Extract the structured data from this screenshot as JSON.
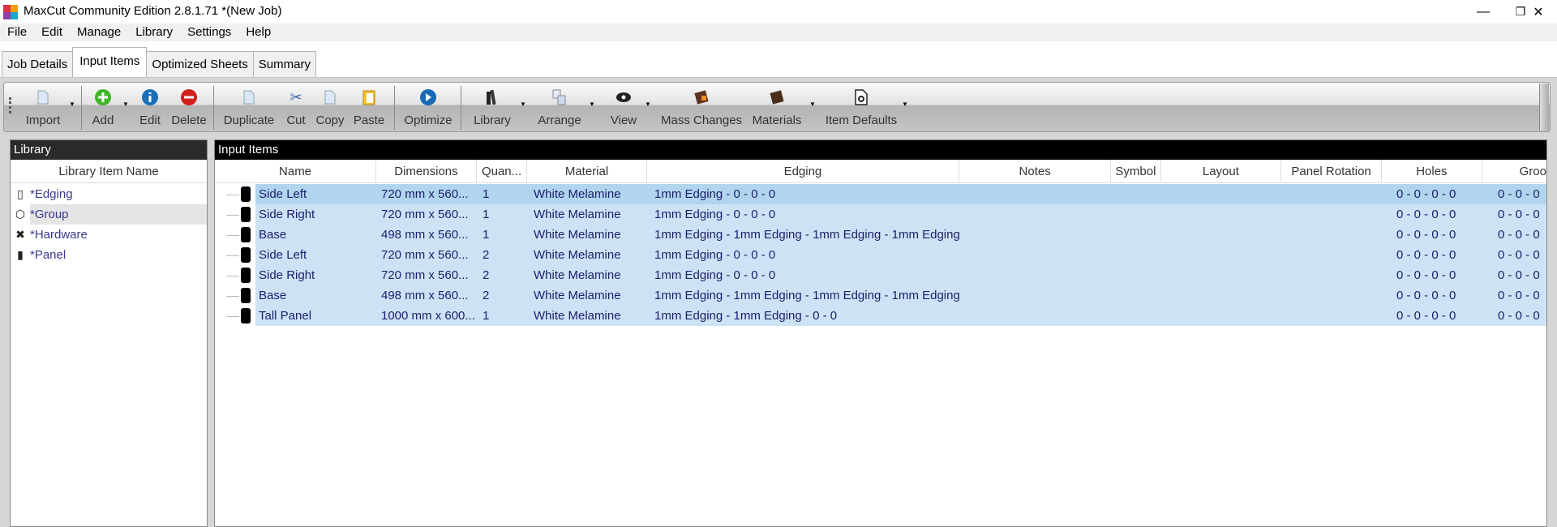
{
  "window": {
    "title": "MaxCut Community Edition 2.8.1.71 *(New Job)",
    "minimize": "—",
    "maximize": "❐",
    "close": "✕"
  },
  "menu": [
    "File",
    "Edit",
    "Manage",
    "Library",
    "Settings",
    "Help"
  ],
  "tabs": [
    {
      "label": "Job Details"
    },
    {
      "label": "Input Items",
      "active": true
    },
    {
      "label": "Optimized Sheets"
    },
    {
      "label": "Summary"
    }
  ],
  "toolbar": {
    "import": "Import",
    "add": "Add",
    "edit": "Edit",
    "delete": "Delete",
    "duplicate": "Duplicate",
    "cut": "Cut",
    "copy": "Copy",
    "paste": "Paste",
    "optimize": "Optimize",
    "library": "Library",
    "arrange": "Arrange",
    "view": "View",
    "mass_changes": "Mass Changes",
    "materials": "Materials",
    "item_defaults": "Item Defaults"
  },
  "library": {
    "title": "Library",
    "column": "Library Item Name",
    "items": [
      {
        "label": "*Edging",
        "icon": "edging-icon"
      },
      {
        "label": "*Group",
        "icon": "group-icon",
        "hover": true
      },
      {
        "label": "*Hardware",
        "icon": "hardware-icon"
      },
      {
        "label": "*Panel",
        "icon": "panel-icon"
      }
    ]
  },
  "input_items": {
    "title": "Input Items",
    "columns": [
      "Name",
      "Dimensions",
      "Quan...",
      "Material",
      "Edging",
      "Notes",
      "Symbol",
      "Layout",
      "Panel Rotation",
      "Holes",
      "Groo"
    ],
    "rows": [
      {
        "name": "Side Left",
        "dimensions": "720 mm x 560...",
        "quantity": "1",
        "material": "White Melamine",
        "edging": "1mm Edging - 0 - 0 - 0",
        "holes": "0 - 0 - 0 - 0",
        "grooves": "0 - 0 - 0",
        "selected": true
      },
      {
        "name": "Side Right",
        "dimensions": "720 mm x 560...",
        "quantity": "1",
        "material": "White Melamine",
        "edging": "1mm Edging - 0 - 0 - 0",
        "holes": "0 - 0 - 0 - 0",
        "grooves": "0 - 0 - 0"
      },
      {
        "name": "Base",
        "dimensions": "498 mm x 560...",
        "quantity": "1",
        "material": "White Melamine",
        "edging": "1mm Edging - 1mm Edging - 1mm Edging - 1mm Edging",
        "holes": "0 - 0 - 0 - 0",
        "grooves": "0 - 0 - 0"
      },
      {
        "name": "Side Left",
        "dimensions": "720 mm x 560...",
        "quantity": "2",
        "material": "White Melamine",
        "edging": "1mm Edging - 0 - 0 - 0",
        "holes": "0 - 0 - 0 - 0",
        "grooves": "0 - 0 - 0"
      },
      {
        "name": "Side Right",
        "dimensions": "720 mm x 560...",
        "quantity": "2",
        "material": "White Melamine",
        "edging": "1mm Edging - 0 - 0 - 0",
        "holes": "0 - 0 - 0 - 0",
        "grooves": "0 - 0 - 0"
      },
      {
        "name": "Base",
        "dimensions": "498 mm x 560...",
        "quantity": "2",
        "material": "White Melamine",
        "edging": "1mm Edging - 1mm Edging - 1mm Edging - 1mm Edging",
        "holes": "0 - 0 - 0 - 0",
        "grooves": "0 - 0 - 0"
      },
      {
        "name": "Tall Panel",
        "dimensions": "1000 mm x 600...",
        "quantity": "1",
        "material": "White Melamine",
        "edging": "1mm Edging - 1mm Edging - 0 - 0",
        "holes": "0 - 0 - 0 - 0",
        "grooves": "0 - 0 - 0"
      }
    ]
  },
  "colors": {
    "row": "#cde3f5",
    "row_selected": "#b1d5ee",
    "row_text": "#1c1c6c",
    "panel_header": "#000000"
  }
}
